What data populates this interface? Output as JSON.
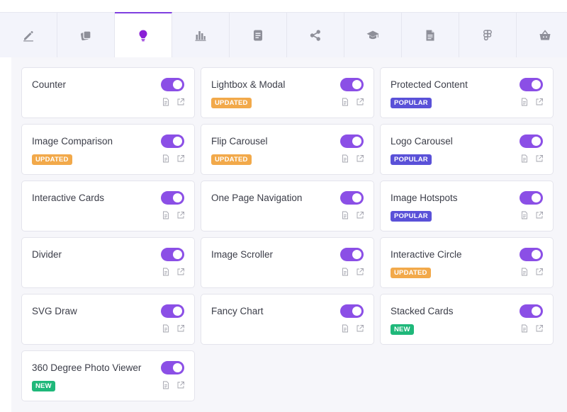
{
  "colors": {
    "accent": "#8b4fe6",
    "updated": "#f2a94a",
    "popular": "#5a51d8",
    "new": "#1fb87a"
  },
  "tabs": [
    {
      "icon": "pencil-icon"
    },
    {
      "icon": "copy-icon"
    },
    {
      "icon": "lightbulb-icon",
      "active": true
    },
    {
      "icon": "bar-chart-icon"
    },
    {
      "icon": "document-icon"
    },
    {
      "icon": "share-icon"
    },
    {
      "icon": "graduation-cap-icon"
    },
    {
      "icon": "file-text-icon"
    },
    {
      "icon": "figma-icon"
    },
    {
      "icon": "basket-icon"
    }
  ],
  "widgets": [
    {
      "title": "Counter",
      "enabled": true
    },
    {
      "title": "Lightbox & Modal",
      "badge": "UPDATED",
      "enabled": true
    },
    {
      "title": "Protected Content",
      "badge": "POPULAR",
      "enabled": true
    },
    {
      "title": "Image Comparison",
      "badge": "UPDATED",
      "enabled": true
    },
    {
      "title": "Flip Carousel",
      "badge": "UPDATED",
      "enabled": true
    },
    {
      "title": "Logo Carousel",
      "badge": "POPULAR",
      "enabled": true
    },
    {
      "title": "Interactive Cards",
      "enabled": true
    },
    {
      "title": "One Page Navigation",
      "enabled": true
    },
    {
      "title": "Image Hotspots",
      "badge": "POPULAR",
      "enabled": true
    },
    {
      "title": "Divider",
      "enabled": true
    },
    {
      "title": "Image Scroller",
      "enabled": true
    },
    {
      "title": "Interactive Circle",
      "badge": "UPDATED",
      "enabled": true
    },
    {
      "title": "SVG Draw",
      "enabled": true
    },
    {
      "title": "Fancy Chart",
      "enabled": true
    },
    {
      "title": "Stacked Cards",
      "badge": "NEW",
      "enabled": true
    },
    {
      "title": "360 Degree Photo Viewer",
      "badge": "NEW",
      "enabled": true
    }
  ]
}
